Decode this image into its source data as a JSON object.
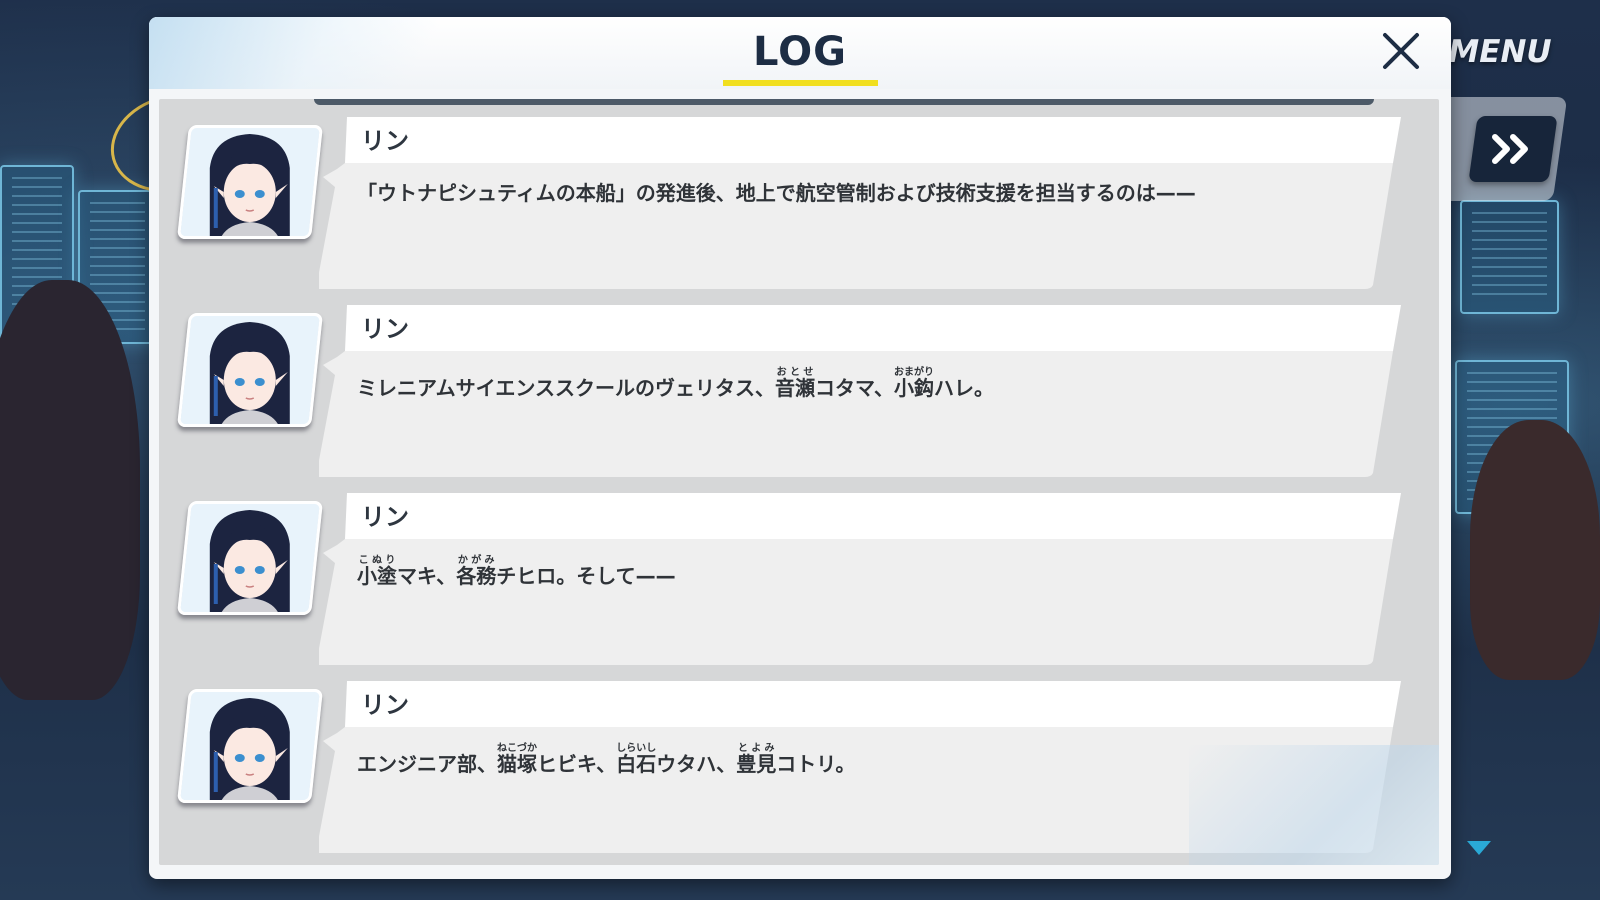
{
  "window": {
    "title": "LOG",
    "close_icon": "close-x-icon"
  },
  "hud": {
    "menu_label": "MENU",
    "skip_icon": "fast-forward-icon",
    "scroll_icon": "chevron-down-icon"
  },
  "colors": {
    "title_underline": "#f1df1f",
    "title_text": "#1d2d44",
    "skip_button": "#17253a"
  },
  "entries": [
    {
      "speaker": "リン",
      "portrait_icon": "character-portrait",
      "segments": [
        {
          "text": "「ウトナピシュティムの本船」の発進後、地上で航空管制および技術支援を担当するのは——"
        }
      ]
    },
    {
      "speaker": "リン",
      "portrait_icon": "character-portrait",
      "segments": [
        {
          "text": "ミレニアムサイエンススクールのヴェリタス、"
        },
        {
          "text": "音瀬",
          "ruby": "おとせ"
        },
        {
          "text": "コタマ、"
        },
        {
          "text": "小鈎",
          "ruby": "おまがり"
        },
        {
          "text": "ハレ。"
        }
      ]
    },
    {
      "speaker": "リン",
      "portrait_icon": "character-portrait",
      "segments": [
        {
          "text": "小塗",
          "ruby": "こぬり"
        },
        {
          "text": "マキ、"
        },
        {
          "text": "各務",
          "ruby": "かがみ"
        },
        {
          "text": "チヒロ。そして——"
        }
      ]
    },
    {
      "speaker": "リン",
      "portrait_icon": "character-portrait",
      "segments": [
        {
          "text": "エンジニア部、"
        },
        {
          "text": "猫塚",
          "ruby": "ねこづか"
        },
        {
          "text": "ヒビキ、"
        },
        {
          "text": "白石",
          "ruby": "しらいし"
        },
        {
          "text": "ウタハ、"
        },
        {
          "text": "豊見",
          "ruby": "とよみ"
        },
        {
          "text": "コトリ。"
        }
      ]
    }
  ]
}
